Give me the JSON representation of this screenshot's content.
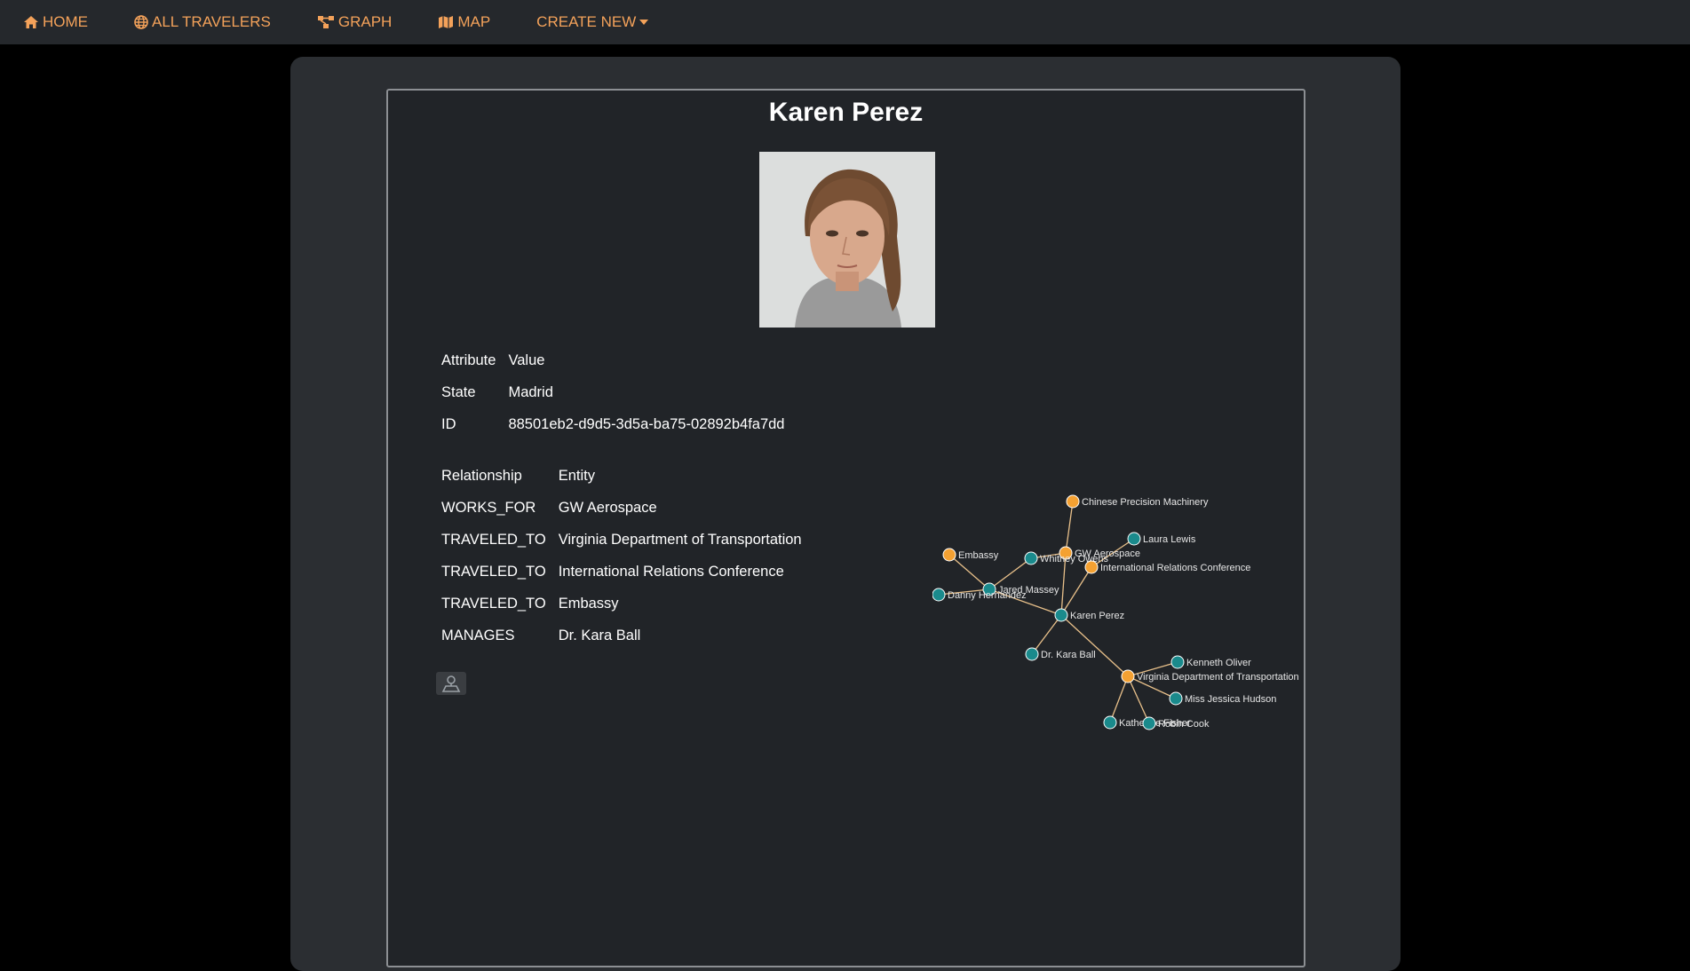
{
  "nav": {
    "home": "HOME",
    "all_travelers": "ALL TRAVELERS",
    "graph": "GRAPH",
    "map": "MAP",
    "create_new": "CREATE NEW"
  },
  "profile": {
    "name": "Karen Perez"
  },
  "attributes": {
    "headers": [
      "Attribute",
      "Value"
    ],
    "rows": [
      {
        "attr": "State",
        "value": "Madrid"
      },
      {
        "attr": "ID",
        "value": "88501eb2-d9d5-3d5a-ba75-02892b4fa7dd"
      }
    ]
  },
  "relationships": {
    "headers": [
      "Relationship",
      "Entity"
    ],
    "rows": [
      {
        "rel": "WORKS_FOR",
        "entity": "GW Aerospace"
      },
      {
        "rel": "TRAVELED_TO",
        "entity": "Virginia Department of Transportation"
      },
      {
        "rel": "TRAVELED_TO",
        "entity": "International Relations Conference"
      },
      {
        "rel": "TRAVELED_TO",
        "entity": "Embassy"
      },
      {
        "rel": "MANAGES",
        "entity": "Dr. Kara Ball"
      }
    ]
  },
  "graph_nodes": [
    {
      "label": "Chinese Precision Machinery",
      "type": "org"
    },
    {
      "label": "Laura Lewis",
      "type": "person"
    },
    {
      "label": "GW Aerospace",
      "type": "org"
    },
    {
      "label": "Whitney Owens",
      "type": "person"
    },
    {
      "label": "International Relations Conference",
      "type": "org"
    },
    {
      "label": "Embassy",
      "type": "org"
    },
    {
      "label": "Jared Massey",
      "type": "person"
    },
    {
      "label": "Danny Hernandez",
      "type": "person"
    },
    {
      "label": "Karen Perez",
      "type": "person"
    },
    {
      "label": "Dr. Kara Ball",
      "type": "person"
    },
    {
      "label": "Kenneth Oliver",
      "type": "person"
    },
    {
      "label": "Virginia Department of Transportation",
      "type": "org"
    },
    {
      "label": "Miss Jessica Hudson",
      "type": "person"
    },
    {
      "label": "Katherine Fisher",
      "type": "person"
    },
    {
      "label": "Robin Cook",
      "type": "person"
    }
  ],
  "colors": {
    "accent": "#f4a25a",
    "org_node": "#f4a132",
    "person_node": "#1a8a8c",
    "edge": "#e8c08a"
  }
}
